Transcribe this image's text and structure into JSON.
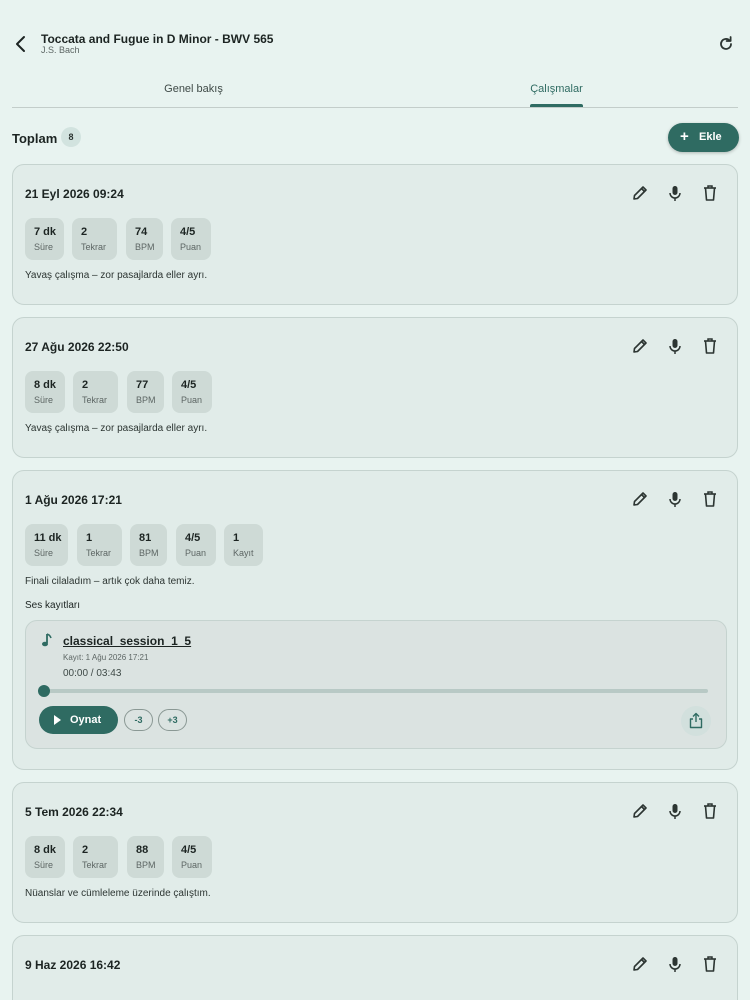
{
  "header": {
    "title": "Toccata and Fugue in D Minor - BWV 565",
    "subtitle": "J.S. Bach"
  },
  "tabs": [
    {
      "label": "Genel bakış",
      "selected": false
    },
    {
      "label": "Çalışmalar",
      "selected": true
    }
  ],
  "summary": {
    "total_label": "Toplam",
    "total_count": "8",
    "add_label": "Ekle"
  },
  "colors": {
    "accent": "#2f6b62",
    "background": "#e8f3f0",
    "card": "#e1ece9",
    "chip": "#cedad6"
  },
  "icons": {
    "back": "arrow-left-icon",
    "refresh": "refresh-icon",
    "edit": "pencil-icon",
    "mic": "microphone-icon",
    "delete": "trash-icon",
    "audio": "music-note-icon",
    "play": "play-icon",
    "share": "share-icon",
    "add": "plus-icon"
  },
  "sessions": [
    {
      "date": "21 Eyl 2026 09:24",
      "stats": [
        {
          "value": "7 dk",
          "label": "Süre"
        },
        {
          "value": "2",
          "label": "Tekrar"
        },
        {
          "value": "74",
          "label": "BPM"
        },
        {
          "value": "4/5",
          "label": "Puan"
        }
      ],
      "note": "Yavaş çalışma – zor pasajlarda eller ayrı."
    },
    {
      "date": "27 Ağu 2026 22:50",
      "stats": [
        {
          "value": "8 dk",
          "label": "Süre"
        },
        {
          "value": "2",
          "label": "Tekrar"
        },
        {
          "value": "77",
          "label": "BPM"
        },
        {
          "value": "4/5",
          "label": "Puan"
        }
      ],
      "note": "Yavaş çalışma – zor pasajlarda eller ayrı."
    },
    {
      "date": "1 Ağu 2026 17:21",
      "stats": [
        {
          "value": "11 dk",
          "label": "Süre"
        },
        {
          "value": "1",
          "label": "Tekrar"
        },
        {
          "value": "81",
          "label": "BPM"
        },
        {
          "value": "4/5",
          "label": "Puan"
        },
        {
          "value": "1",
          "label": "Kayıt"
        }
      ],
      "note": "Finali cilaladım – artık çok daha temiz.",
      "recordings_label": "Ses kayıtları",
      "recording": {
        "name": "classical_session_1_5",
        "date": "Kayıt: 1 Ağu 2026 17:21",
        "time": "00:00 / 03:43",
        "progress": 0,
        "play_label": "Oynat",
        "back_label": "-3",
        "fwd_label": "+3"
      }
    },
    {
      "date": "5 Tem 2026 22:34",
      "stats": [
        {
          "value": "8 dk",
          "label": "Süre"
        },
        {
          "value": "2",
          "label": "Tekrar"
        },
        {
          "value": "88",
          "label": "BPM"
        },
        {
          "value": "4/5",
          "label": "Puan"
        }
      ],
      "note": "Nüanslar ve cümleleme üzerinde çalıştım."
    },
    {
      "date": "9 Haz 2026 16:42"
    }
  ]
}
